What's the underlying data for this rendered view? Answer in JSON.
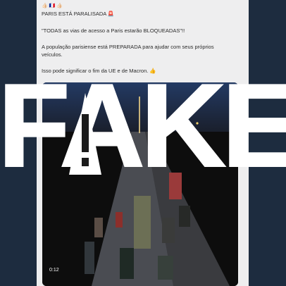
{
  "post": {
    "emoji_line": "👍🏻 🇫🇷 👍🏻",
    "line1": "PARIS ESTÁ PARALISADA 🚨",
    "line2": "\"TODAS as vias de acesso a Paris estarão BLOQUEADAS\"!!",
    "line3": "A população parisiense está PREPARADA para ajudar com seus próprios",
    "line4": "veículos.",
    "line5": "Isso pode significar o fim da UE e de Macron. 👍"
  },
  "video": {
    "timestamp": "0:12"
  },
  "overlay": {
    "fake_label": "FAKE"
  },
  "colors": {
    "background": "#1d2c3f",
    "overlay_text": "#ffffff"
  }
}
